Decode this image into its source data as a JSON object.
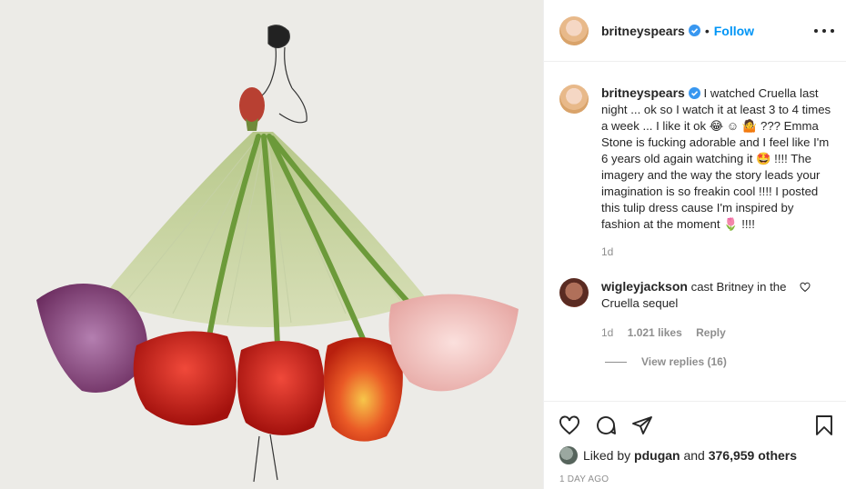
{
  "post": {
    "author": "britneyspears",
    "follow_label": "Follow",
    "separator": "•",
    "caption": "I watched Cruella last night ... ok so I watch it at least 3 to 4 times a week ... I like it ok 😂 ☺ 🤷 ??? Emma Stone is fucking adorable and I feel like I'm 6 years old again watching it 🤩 !!!! The imagery and the way the story leads your imagination is so freakin cool !!!! I posted this tulip dress cause I'm inspired by fashion at the moment 🌷 !!!!",
    "caption_age": "1d",
    "liked_by_prefix": "Liked by",
    "liked_by_user": "pdugan",
    "liked_by_and": "and",
    "liked_by_count": "376,959 others",
    "time_ago": "1 DAY AGO"
  },
  "comment": {
    "author": "wigleyjackson",
    "text": "cast Britney in the Cruella sequel",
    "age": "1d",
    "likes": "1.021 likes",
    "reply_label": "Reply",
    "view_replies": "View replies (16)"
  },
  "icons": {
    "like": "heart-icon",
    "comment": "comment-icon",
    "share": "share-icon",
    "save": "bookmark-icon",
    "more": "more-options-icon"
  },
  "colors": {
    "accent": "#0095f6",
    "verified": "#3897f0",
    "text": "#262626",
    "muted": "#8e8e8e"
  }
}
